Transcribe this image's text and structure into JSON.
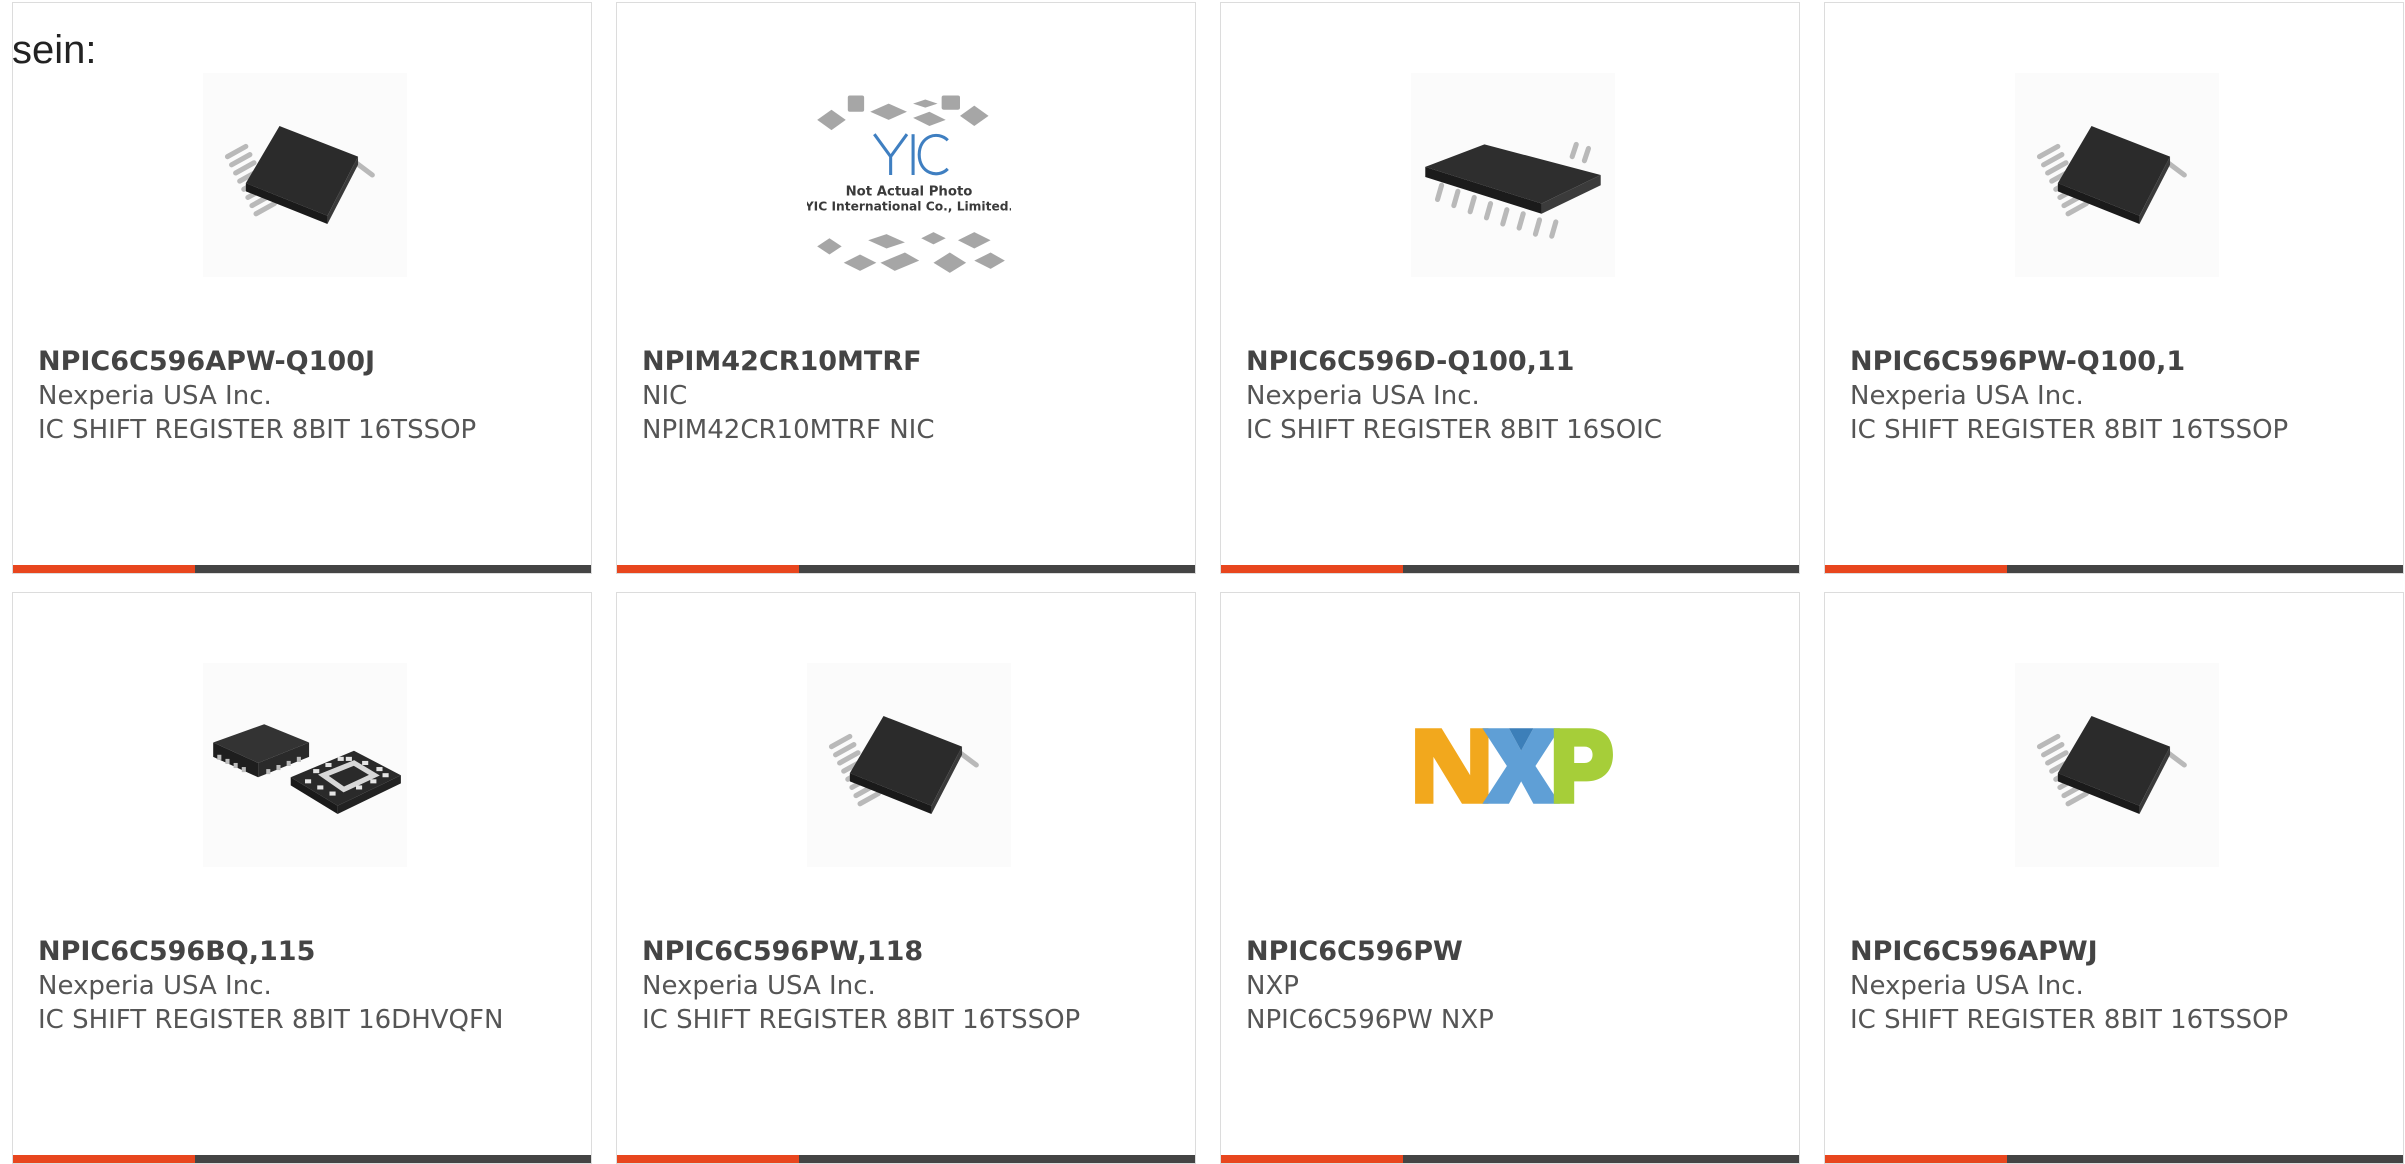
{
  "intro_text": "sein:",
  "colors": {
    "accent": "#e8461e",
    "bar_dark": "#444444",
    "card_border": "#dcdcdc"
  },
  "yic_photo": {
    "line1": "Not Actual Photo",
    "line2": "YIC International Co., Limited."
  },
  "products": [
    {
      "part_number": "NPIC6C596APW-Q100J",
      "manufacturer": "Nexperia USA Inc.",
      "description": "IC SHIFT REGISTER 8BIT 16TSSOP",
      "image": "tssop-chip-icon"
    },
    {
      "part_number": "NPIM42CR10MTRF",
      "manufacturer": "NIC",
      "description": "NPIM42CR10MTRF NIC",
      "image": "yic-not-actual-photo"
    },
    {
      "part_number": "NPIC6C596D-Q100,11",
      "manufacturer": "Nexperia USA Inc.",
      "description": "IC SHIFT REGISTER 8BIT 16SOIC",
      "image": "soic-chip-icon"
    },
    {
      "part_number": "NPIC6C596PW-Q100,1",
      "manufacturer": "Nexperia USA Inc.",
      "description": "IC SHIFT REGISTER 8BIT 16TSSOP",
      "image": "tssop-chip-icon"
    },
    {
      "part_number": "NPIC6C596BQ,115",
      "manufacturer": "Nexperia USA Inc.",
      "description": "IC SHIFT REGISTER 8BIT 16DHVQFN",
      "image": "dhvqfn-chip-icon"
    },
    {
      "part_number": "NPIC6C596PW,118",
      "manufacturer": "Nexperia USA Inc.",
      "description": "IC SHIFT REGISTER 8BIT 16TSSOP",
      "image": "tssop-chip-icon"
    },
    {
      "part_number": "NPIC6C596PW",
      "manufacturer": "NXP",
      "description": "NPIC6C596PW NXP",
      "image": "nxp-logo"
    },
    {
      "part_number": "NPIC6C596APWJ",
      "manufacturer": "Nexperia USA Inc.",
      "description": "IC SHIFT REGISTER 8BIT 16TSSOP",
      "image": "tssop-chip-icon"
    }
  ]
}
